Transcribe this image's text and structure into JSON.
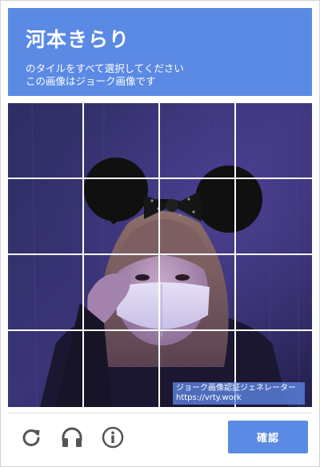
{
  "header": {
    "title": "河本きらり",
    "instruction_line1": "のタイルをすべて選択してください",
    "instruction_line2": "この画像はジョーク画像です"
  },
  "grid": {
    "rows": 4,
    "columns": 4
  },
  "watermark": {
    "line1": "ジョーク画像認証ジェネレーター",
    "line2": "https://vrty.work"
  },
  "footer": {
    "reload_icon": "reload-icon",
    "audio_icon": "headphones-icon",
    "info_icon": "info-icon",
    "verify_label": "確認"
  },
  "colors": {
    "accent": "#5b8ae4",
    "icon": "#555555",
    "photo_wall": "#2b2a5a"
  }
}
